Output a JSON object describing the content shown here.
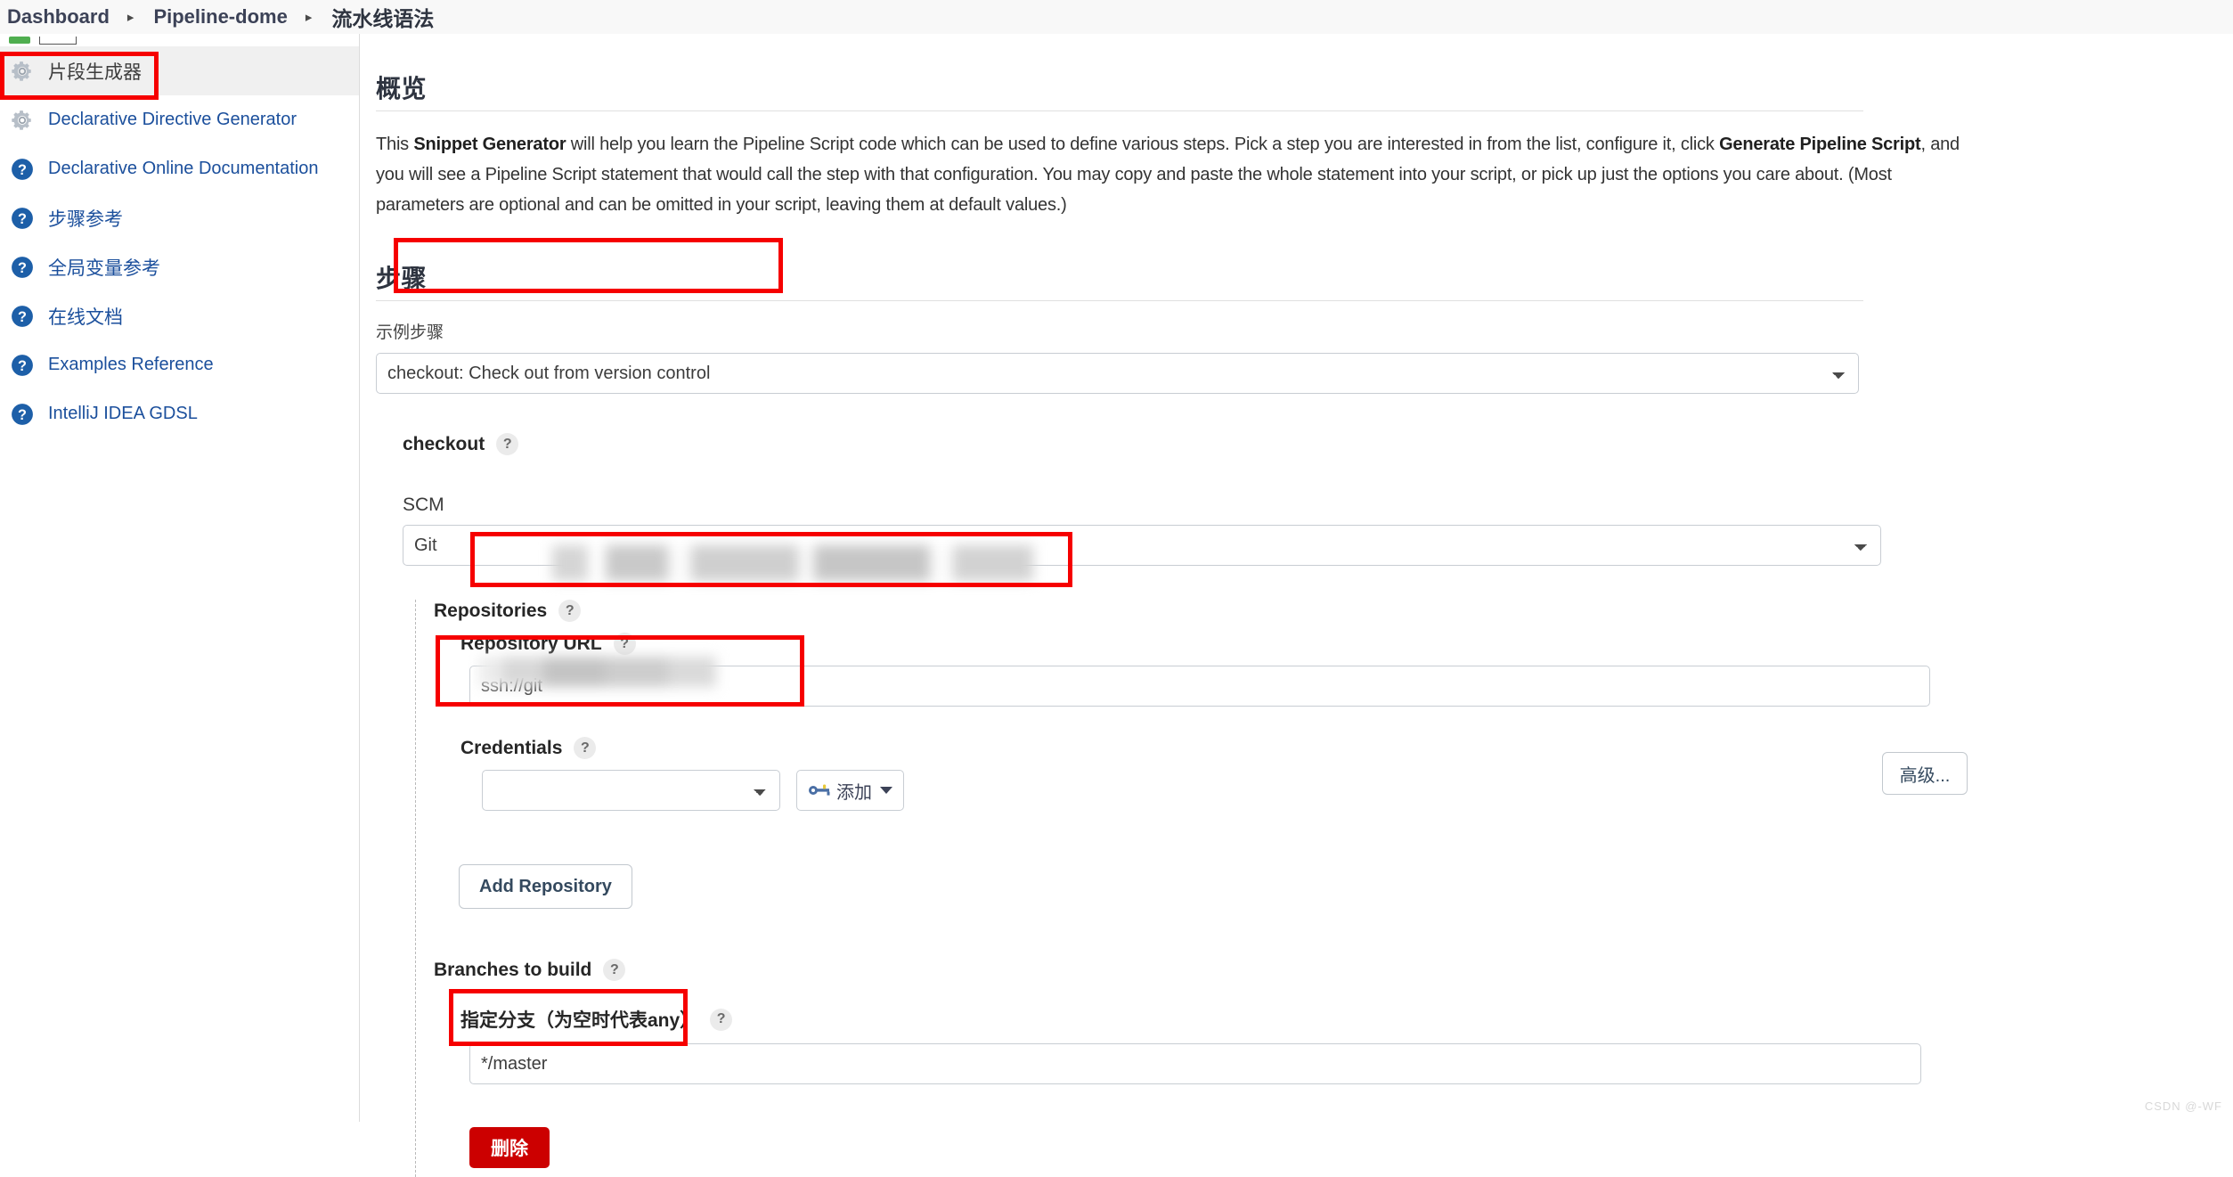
{
  "breadcrumb": {
    "items": [
      "Dashboard",
      "Pipeline-dome",
      "流水线语法"
    ],
    "separator": "▸"
  },
  "sidebar": {
    "items": [
      {
        "label": "片段生成器",
        "icon": "gear-icon",
        "active": true
      },
      {
        "label": "Declarative Directive Generator",
        "icon": "gear-icon",
        "active": false
      },
      {
        "label": "Declarative Online Documentation",
        "icon": "help-circle-icon",
        "active": false
      },
      {
        "label": "步骤参考",
        "icon": "help-circle-icon",
        "active": false
      },
      {
        "label": "全局变量参考",
        "icon": "help-circle-icon",
        "active": false
      },
      {
        "label": "在线文档",
        "icon": "help-circle-icon",
        "active": false
      },
      {
        "label": "Examples Reference",
        "icon": "help-circle-icon",
        "active": false
      },
      {
        "label": "IntelliJ IDEA GDSL",
        "icon": "help-circle-icon",
        "active": false
      }
    ]
  },
  "overview": {
    "title": "概览",
    "paragraph_part1": "This ",
    "paragraph_bold1": "Snippet Generator",
    "paragraph_part2": " will help you learn the Pipeline Script code which can be used to define various steps. Pick a step you are interested in from the list, configure it, click ",
    "paragraph_bold2": "Generate Pipeline Script",
    "paragraph_part3": ", and you will see a Pipeline Script statement that would call the step with that configuration. You may copy and paste the whole statement into your script, or pick up just the options you care about. (Most parameters are optional and can be omitted in your script, leaving them at default values.)"
  },
  "steps": {
    "title": "步骤",
    "sample_step_label": "示例步骤",
    "sample_step_value": "checkout: Check out from version control",
    "checkout": {
      "title": "checkout",
      "help": "?",
      "scm_label": "SCM",
      "scm_value": "Git",
      "repositories": {
        "label": "Repositories",
        "help": "?",
        "repository_url": {
          "label": "Repository URL",
          "help": "?",
          "value": "ssh://git",
          "value_redacted": true
        },
        "credentials": {
          "label": "Credentials",
          "help": "?",
          "value": "",
          "value_redacted": true,
          "add_button_label": "添加",
          "add_button_icon": "key-icon",
          "add_button_caret": "chevron-down-icon"
        },
        "advanced_button_label": "高级...",
        "add_repository_button_label": "Add Repository"
      },
      "branches": {
        "label": "Branches to build",
        "help": "?",
        "branch_specifier_label": "指定分支（为空时代表any）",
        "branch_specifier_help": "?",
        "branch_specifier_value": "*/master"
      },
      "delete_button_label": "删除"
    }
  },
  "watermark": "CSDN @-WF",
  "colors": {
    "annotation": "#f60000",
    "link": "#1b4f9c",
    "danger": "#cc0000",
    "sidebar_active_bg": "#f0f0f0"
  }
}
